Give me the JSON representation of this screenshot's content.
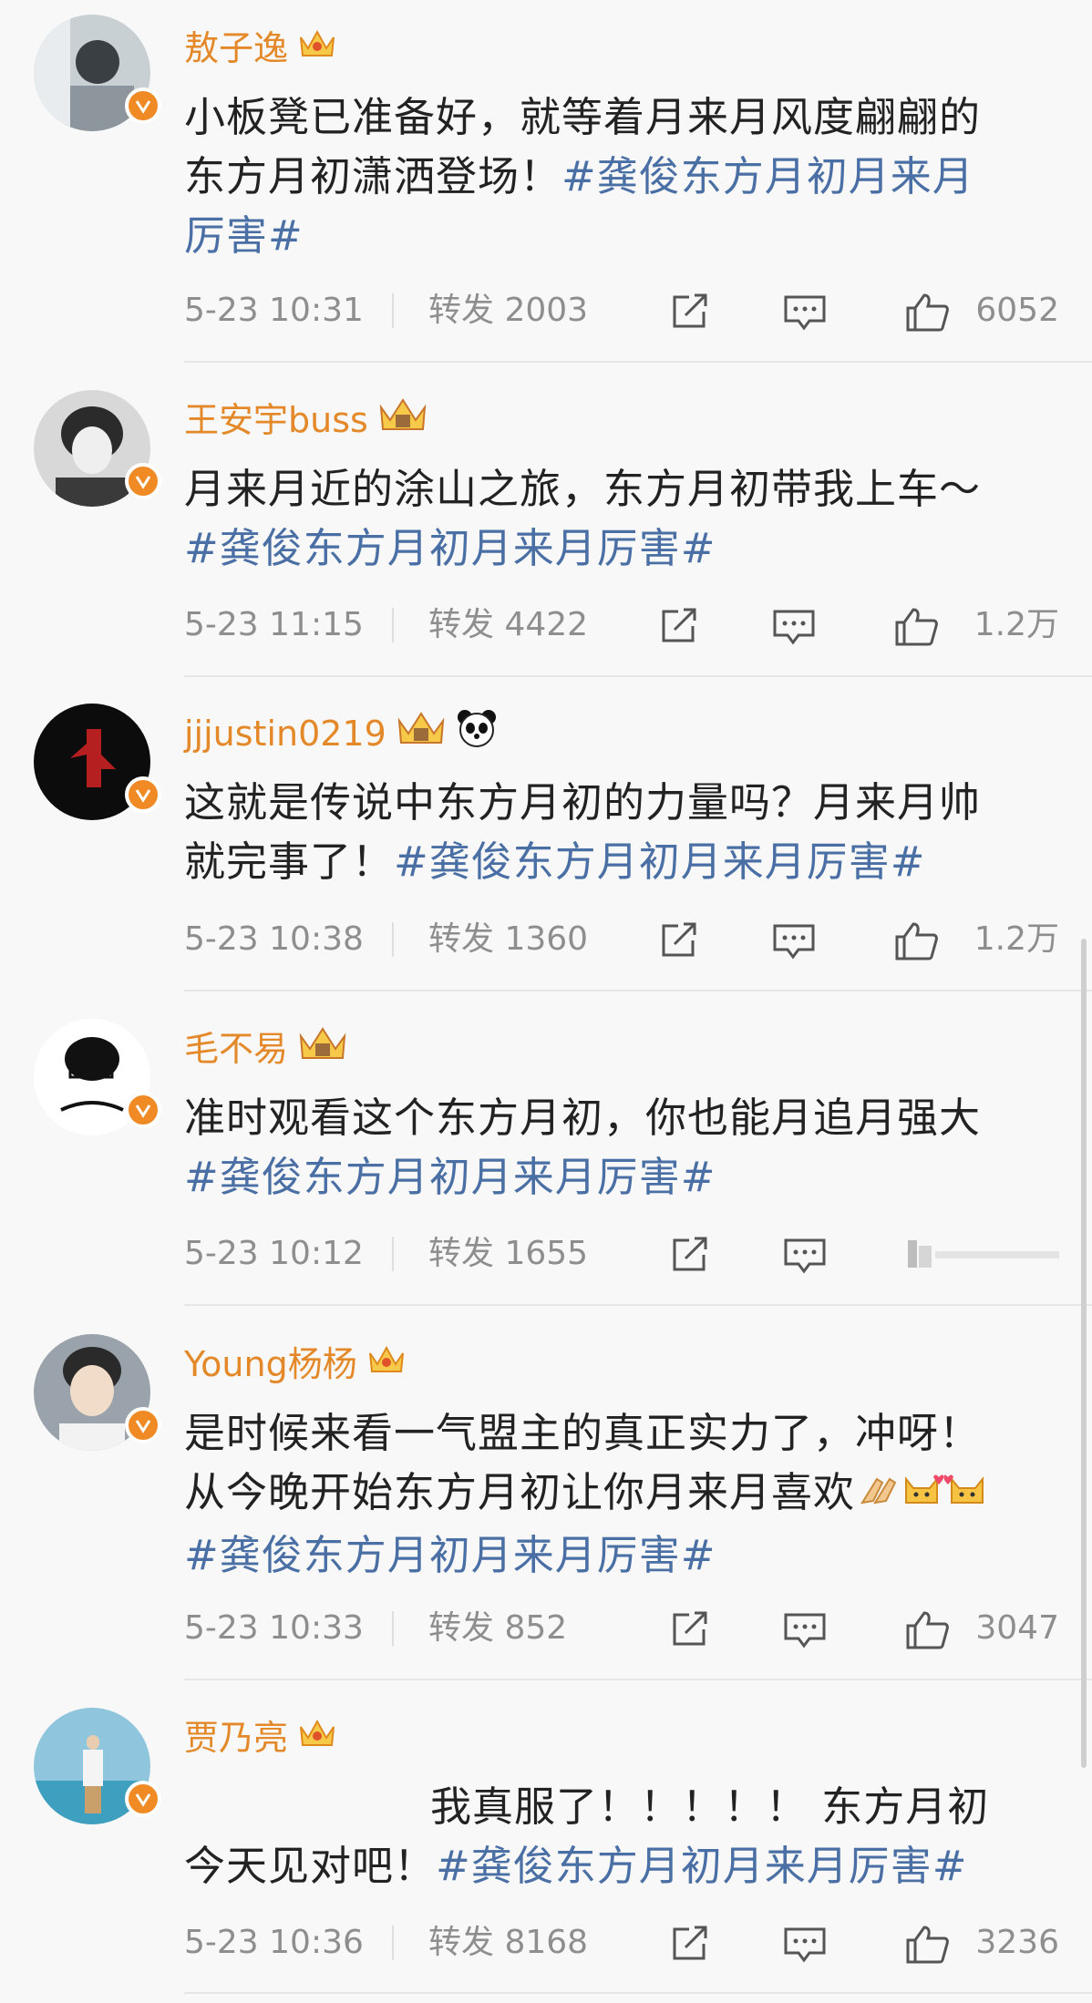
{
  "posts": [
    {
      "author": "敖子逸",
      "line1": "小板凳已准备好，就等着月来月风度翩翩的",
      "line2_text": "东方月初潇洒登场！",
      "line2_tag": "#龚俊东方月初月来月",
      "line3_tag": "厉害#",
      "time": "5-23 10:31",
      "repost": "转发 2003",
      "likes": "6052"
    },
    {
      "author": "王安宇buss",
      "line1": "月来月近的涂山之旅，东方月初带我上车～",
      "line2_tag": "#龚俊东方月初月来月厉害#",
      "time": "5-23 11:15",
      "repost": "转发 4422",
      "likes": "1.2万"
    },
    {
      "author": "jjjustin0219",
      "line1": "这就是传说中东方月初的力量吗？月来月帅",
      "line2_text": "就完事了！",
      "line2_tag": "#龚俊东方月初月来月厉害#",
      "time": "5-23 10:38",
      "repost": "转发 1360",
      "likes": "1.2万"
    },
    {
      "author": "毛不易",
      "line1": "准时观看这个东方月初，你也能月追月强大",
      "line2_tag": "#龚俊东方月初月来月厉害#",
      "time": "5-23 10:12",
      "repost": "转发 1655",
      "likes": ""
    },
    {
      "author": "Young杨杨",
      "line1": "是时候来看一气盟主的真正实力了，冲呀！",
      "line2_text": "从今晚开始东方月初让你月来月喜欢",
      "line3_tag": "#龚俊东方月初月来月厉害#",
      "time": "5-23 10:33",
      "repost": "转发 852",
      "likes": "3047"
    },
    {
      "author": "贾乃亮",
      "line1": "我真服了！！！！！ 东方月初",
      "line2_text": "今天见对吧！",
      "line2_tag": "#龚俊东方月初月来月厉害#",
      "time": "5-23 10:36",
      "repost": "转发 8168",
      "likes": "3236"
    }
  ],
  "icons": {
    "share": "share-icon",
    "comment": "comment-icon",
    "like": "like-icon",
    "verified": "verified-badge-icon",
    "crown": "crown-icon",
    "panda": "panda-icon",
    "hands": "hands-emoji-icon",
    "cat": "cat-emoji-icon"
  },
  "colors": {
    "author": "#e4892a",
    "tag": "#4a6fa5",
    "meta": "#8e8e8e",
    "badge": "#f08a24"
  }
}
